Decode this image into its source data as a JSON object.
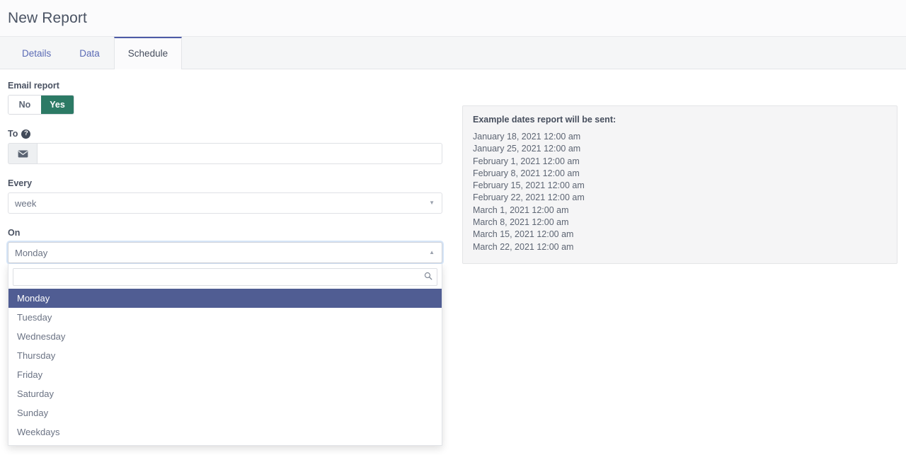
{
  "header": {
    "title": "New Report"
  },
  "tabs": [
    {
      "label": "Details",
      "active": false
    },
    {
      "label": "Data",
      "active": false
    },
    {
      "label": "Schedule",
      "active": true
    }
  ],
  "form": {
    "email_report": {
      "label": "Email report",
      "options": [
        "No",
        "Yes"
      ],
      "selected": "Yes",
      "active_color": "#2c7a65"
    },
    "to": {
      "label": "To",
      "help_glyph": "?",
      "addon_icon": "envelope-icon",
      "value": "",
      "placeholder": ""
    },
    "every": {
      "label": "Every",
      "value": "week",
      "caret": "▼"
    },
    "on": {
      "label": "On",
      "value": "Monday",
      "caret": "▲",
      "open": true,
      "search_value": "",
      "search_placeholder": "",
      "search_icon": "search-icon",
      "options": [
        "Monday",
        "Tuesday",
        "Wednesday",
        "Thursday",
        "Friday",
        "Saturday",
        "Sunday",
        "Weekdays"
      ],
      "selected_index": 0,
      "highlight_color": "#505d93"
    }
  },
  "example": {
    "title": "Example dates report will be sent:",
    "dates": [
      "January 18, 2021 12:00 am",
      "January 25, 2021 12:00 am",
      "February 1, 2021 12:00 am",
      "February 8, 2021 12:00 am",
      "February 15, 2021 12:00 am",
      "February 22, 2021 12:00 am",
      "March 1, 2021 12:00 am",
      "March 8, 2021 12:00 am",
      "March 15, 2021 12:00 am",
      "March 22, 2021 12:00 am"
    ]
  }
}
